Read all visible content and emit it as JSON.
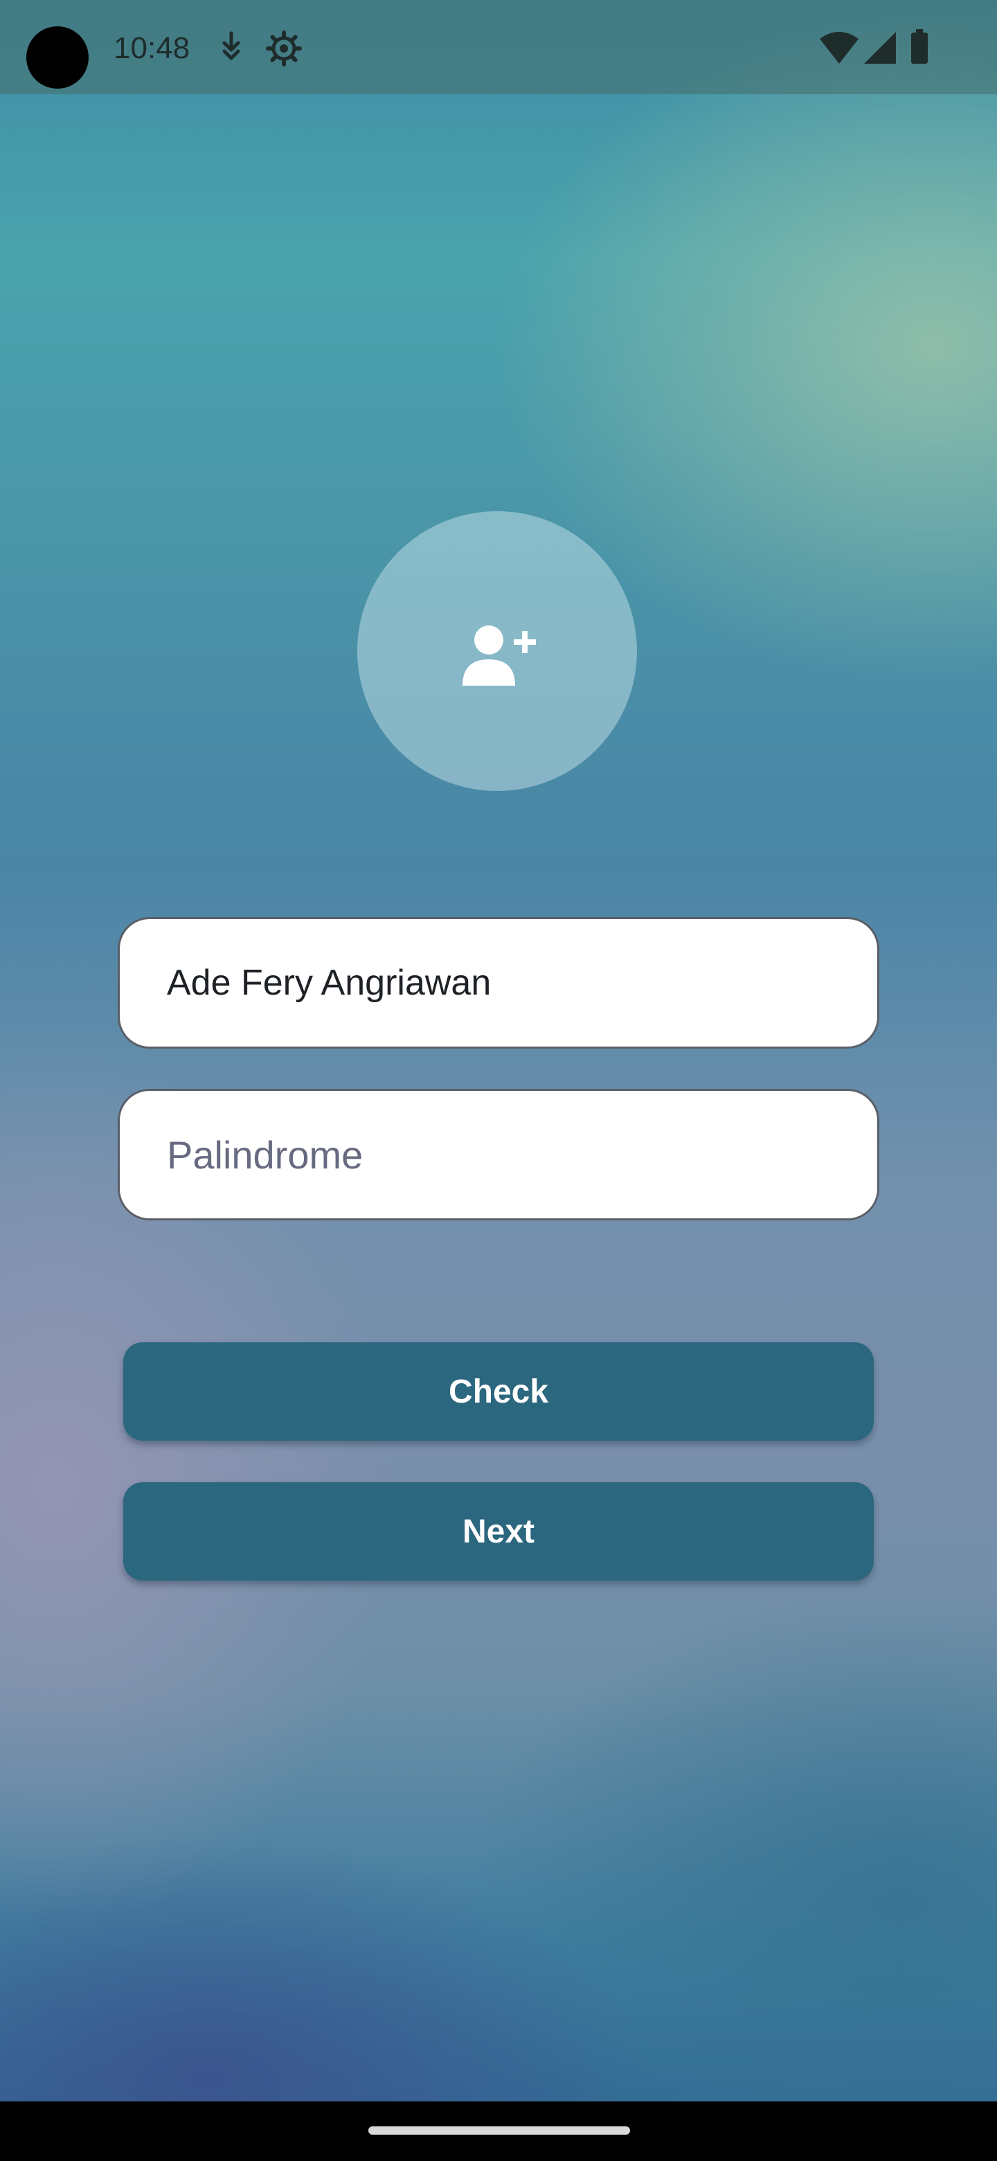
{
  "status_bar": {
    "time": "10:48",
    "icons": [
      "download-icon",
      "settings-gear-icon",
      "wifi-icon",
      "cellular-signal-icon",
      "battery-icon"
    ]
  },
  "avatar": {
    "icon": "add-user-icon"
  },
  "form": {
    "name_field": {
      "value": "Ade Fery Angriawan",
      "placeholder": ""
    },
    "palindrome_field": {
      "value": "",
      "placeholder": "Palindrome"
    }
  },
  "buttons": {
    "check_label": "Check",
    "next_label": "Next"
  },
  "colors": {
    "button": "#2b677e",
    "field_background": "#ffffff",
    "placeholder": "#676a80"
  }
}
